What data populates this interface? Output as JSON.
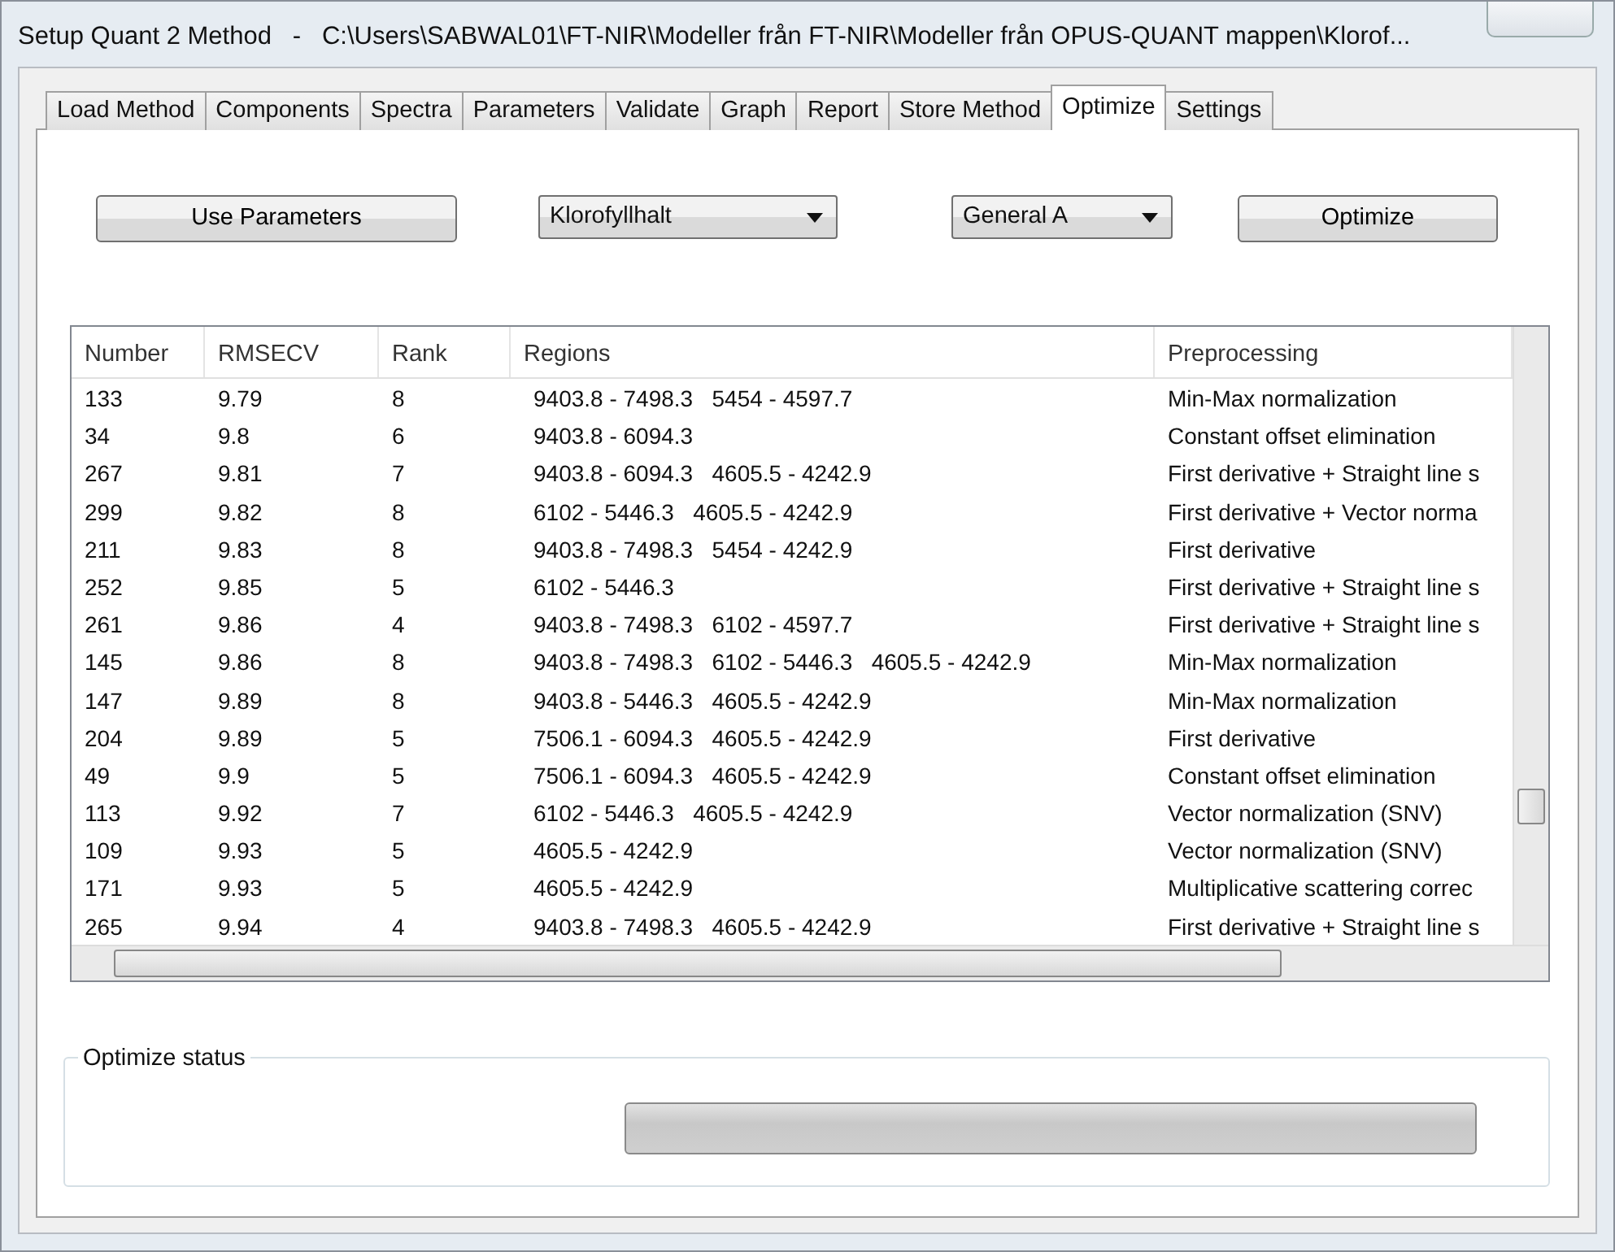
{
  "window": {
    "title": "Setup Quant 2 Method   -   C:\\Users\\SABWAL01\\FT-NIR\\Modeller från FT-NIR\\Modeller från OPUS-QUANT mappen\\Klorof..."
  },
  "tabs": [
    {
      "label": "Load Method",
      "selected": false
    },
    {
      "label": "Components",
      "selected": false
    },
    {
      "label": "Spectra",
      "selected": false
    },
    {
      "label": "Parameters",
      "selected": false
    },
    {
      "label": "Validate",
      "selected": false
    },
    {
      "label": "Graph",
      "selected": false
    },
    {
      "label": "Report",
      "selected": false
    },
    {
      "label": "Store Method",
      "selected": false
    },
    {
      "label": "Optimize",
      "selected": true
    },
    {
      "label": "Settings",
      "selected": false
    }
  ],
  "toolbar": [
    {
      "kind": "button",
      "label": "Use Parameters"
    },
    {
      "kind": "dropdown",
      "value": "Klorofyllhalt"
    },
    {
      "kind": "dropdown",
      "value": "General A"
    },
    {
      "kind": "button",
      "label": "Optimize"
    }
  ],
  "table": {
    "columns": [
      "Number",
      "RMSECV",
      "Rank",
      "Regions",
      "Preprocessing"
    ],
    "rows": [
      [
        "133",
        "9.79",
        "8",
        "9403.8 - 7498.3   5454 - 4597.7",
        "Min-Max normalization"
      ],
      [
        "34",
        "9.8",
        "6",
        "9403.8 - 6094.3",
        "Constant offset elimination"
      ],
      [
        "267",
        "9.81",
        "7",
        "9403.8 - 6094.3   4605.5 - 4242.9",
        "First derivative + Straight line s"
      ],
      [
        "299",
        "9.82",
        "8",
        "6102 - 5446.3   4605.5 - 4242.9",
        "First derivative + Vector norma"
      ],
      [
        "211",
        "9.83",
        "8",
        "9403.8 - 7498.3   5454 - 4242.9",
        "First derivative"
      ],
      [
        "252",
        "9.85",
        "5",
        "6102 - 5446.3",
        "First derivative + Straight line s"
      ],
      [
        "261",
        "9.86",
        "4",
        "9403.8 - 7498.3   6102 - 4597.7",
        "First derivative + Straight line s"
      ],
      [
        "145",
        "9.86",
        "8",
        "9403.8 - 7498.3   6102 - 5446.3   4605.5 - 4242.9",
        "Min-Max normalization"
      ],
      [
        "147",
        "9.89",
        "8",
        "9403.8 - 5446.3   4605.5 - 4242.9",
        "Min-Max normalization"
      ],
      [
        "204",
        "9.89",
        "5",
        "7506.1 - 6094.3   4605.5 - 4242.9",
        "First derivative"
      ],
      [
        "49",
        "9.9",
        "5",
        "7506.1 - 6094.3   4605.5 - 4242.9",
        "Constant offset elimination"
      ],
      [
        "113",
        "9.92",
        "7",
        "6102 - 5446.3   4605.5 - 4242.9",
        "Vector normalization (SNV)"
      ],
      [
        "109",
        "9.93",
        "5",
        "4605.5 - 4242.9",
        "Vector normalization (SNV)"
      ],
      [
        "171",
        "9.93",
        "5",
        "4605.5 - 4242.9",
        "Multiplicative scattering correc"
      ],
      [
        "265",
        "9.94",
        "4",
        "9403.8 - 7498.3   4605.5 - 4242.9",
        "First derivative + Straight line s"
      ]
    ]
  },
  "status": {
    "title": "Optimize status",
    "level": 0
  }
}
